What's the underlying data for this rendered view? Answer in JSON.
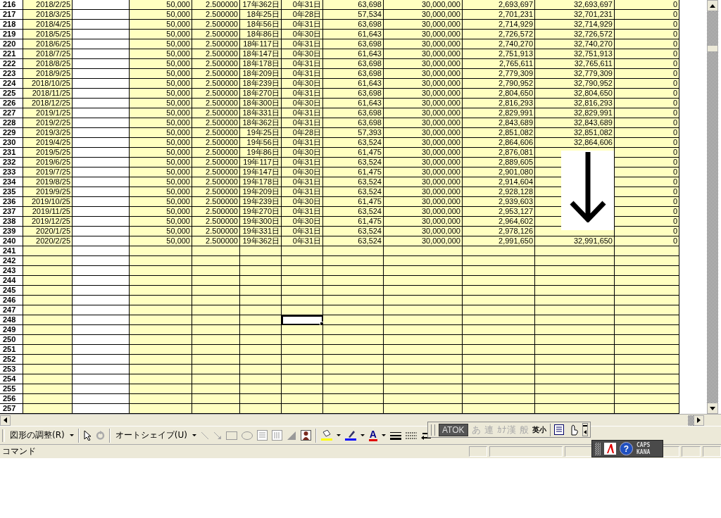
{
  "sheet": {
    "rows": [
      {
        "number": "216",
        "cells": [
          "2018/2/25",
          "50,000",
          "2.500000",
          "17年362日",
          "0年31日",
          "63,698",
          "30,000,000",
          "2,693,697",
          "32,693,697",
          "0"
        ]
      },
      {
        "number": "217",
        "cells": [
          "2018/3/25",
          "50,000",
          "2.500000",
          "18年25日",
          "0年28日",
          "57,534",
          "30,000,000",
          "2,701,231",
          "32,701,231",
          "0"
        ]
      },
      {
        "number": "218",
        "cells": [
          "2018/4/25",
          "50,000",
          "2.500000",
          "18年56日",
          "0年31日",
          "63,698",
          "30,000,000",
          "2,714,929",
          "32,714,929",
          "0"
        ]
      },
      {
        "number": "219",
        "cells": [
          "2018/5/25",
          "50,000",
          "2.500000",
          "18年86日",
          "0年30日",
          "61,643",
          "30,000,000",
          "2,726,572",
          "32,726,572",
          "0"
        ]
      },
      {
        "number": "220",
        "cells": [
          "2018/6/25",
          "50,000",
          "2.500000",
          "18年117日",
          "0年31日",
          "63,698",
          "30,000,000",
          "2,740,270",
          "32,740,270",
          "0"
        ]
      },
      {
        "number": "221",
        "cells": [
          "2018/7/25",
          "50,000",
          "2.500000",
          "18年147日",
          "0年30日",
          "61,643",
          "30,000,000",
          "2,751,913",
          "32,751,913",
          "0"
        ]
      },
      {
        "number": "222",
        "cells": [
          "2018/8/25",
          "50,000",
          "2.500000",
          "18年178日",
          "0年31日",
          "63,698",
          "30,000,000",
          "2,765,611",
          "32,765,611",
          "0"
        ]
      },
      {
        "number": "223",
        "cells": [
          "2018/9/25",
          "50,000",
          "2.500000",
          "18年209日",
          "0年31日",
          "63,698",
          "30,000,000",
          "2,779,309",
          "32,779,309",
          "0"
        ]
      },
      {
        "number": "224",
        "cells": [
          "2018/10/25",
          "50,000",
          "2.500000",
          "18年239日",
          "0年30日",
          "61,643",
          "30,000,000",
          "2,790,952",
          "32,790,952",
          "0"
        ]
      },
      {
        "number": "225",
        "cells": [
          "2018/11/25",
          "50,000",
          "2.500000",
          "18年270日",
          "0年31日",
          "63,698",
          "30,000,000",
          "2,804,650",
          "32,804,650",
          "0"
        ]
      },
      {
        "number": "226",
        "cells": [
          "2018/12/25",
          "50,000",
          "2.500000",
          "18年300日",
          "0年30日",
          "61,643",
          "30,000,000",
          "2,816,293",
          "32,816,293",
          "0"
        ]
      },
      {
        "number": "227",
        "cells": [
          "2019/1/25",
          "50,000",
          "2.500000",
          "18年331日",
          "0年31日",
          "63,698",
          "30,000,000",
          "2,829,991",
          "32,829,991",
          "0"
        ]
      },
      {
        "number": "228",
        "cells": [
          "2019/2/25",
          "50,000",
          "2.500000",
          "18年362日",
          "0年31日",
          "63,698",
          "30,000,000",
          "2,843,689",
          "32,843,689",
          "0"
        ]
      },
      {
        "number": "229",
        "cells": [
          "2019/3/25",
          "50,000",
          "2.500000",
          "19年25日",
          "0年28日",
          "57,393",
          "30,000,000",
          "2,851,082",
          "32,851,082",
          "0"
        ]
      },
      {
        "number": "230",
        "cells": [
          "2019/4/25",
          "50,000",
          "2.500000",
          "19年56日",
          "0年31日",
          "63,524",
          "30,000,000",
          "2,864,606",
          "32,864,606",
          "0"
        ]
      },
      {
        "number": "231",
        "cells": [
          "2019/5/25",
          "50,000",
          "2.500000",
          "19年86日",
          "0年30日",
          "61,475",
          "30,000,000",
          "2,876,081",
          null,
          "0"
        ]
      },
      {
        "number": "232",
        "cells": [
          "2019/6/25",
          "50,000",
          "2.500000",
          "19年117日",
          "0年31日",
          "63,524",
          "30,000,000",
          "2,889,605",
          null,
          "0"
        ]
      },
      {
        "number": "233",
        "cells": [
          "2019/7/25",
          "50,000",
          "2.500000",
          "19年147日",
          "0年30日",
          "61,475",
          "30,000,000",
          "2,901,080",
          null,
          "0"
        ]
      },
      {
        "number": "234",
        "cells": [
          "2019/8/25",
          "50,000",
          "2.500000",
          "19年178日",
          "0年31日",
          "63,524",
          "30,000,000",
          "2,914,604",
          null,
          "0"
        ]
      },
      {
        "number": "235",
        "cells": [
          "2019/9/25",
          "50,000",
          "2.500000",
          "19年209日",
          "0年31日",
          "63,524",
          "30,000,000",
          "2,928,128",
          null,
          "0"
        ]
      },
      {
        "number": "236",
        "cells": [
          "2019/10/25",
          "50,000",
          "2.500000",
          "19年239日",
          "0年30日",
          "61,475",
          "30,000,000",
          "2,939,603",
          null,
          "0"
        ]
      },
      {
        "number": "237",
        "cells": [
          "2019/11/25",
          "50,000",
          "2.500000",
          "19年270日",
          "0年31日",
          "63,524",
          "30,000,000",
          "2,953,127",
          null,
          "0"
        ]
      },
      {
        "number": "238",
        "cells": [
          "2019/12/25",
          "50,000",
          "2.500000",
          "19年300日",
          "0年30日",
          "61,475",
          "30,000,000",
          "2,964,602",
          null,
          "0"
        ]
      },
      {
        "number": "239",
        "cells": [
          "2020/1/25",
          "50,000",
          "2.500000",
          "19年331日",
          "0年31日",
          "63,524",
          "30,000,000",
          "2,978,126",
          null,
          "0"
        ]
      },
      {
        "number": "240",
        "cells": [
          "2020/2/25",
          "50,000",
          "2.500000",
          "19年362日",
          "0年31日",
          "63,524",
          "30,000,000",
          "2,991,650",
          "32,991,650",
          "0"
        ]
      },
      {
        "number": "241",
        "selected": false
      },
      {
        "number": "242",
        "selected": false
      },
      {
        "number": "243",
        "selected": false
      },
      {
        "number": "244",
        "selected": false
      },
      {
        "number": "245",
        "selected": false
      },
      {
        "number": "246",
        "selected": false
      },
      {
        "number": "247",
        "selected": false
      },
      {
        "number": "248",
        "selected": true
      },
      {
        "number": "249",
        "selected": false
      },
      {
        "number": "250",
        "selected": false
      },
      {
        "number": "251",
        "selected": false
      },
      {
        "number": "252",
        "selected": false
      },
      {
        "number": "253",
        "selected": false
      },
      {
        "number": "254",
        "selected": false
      },
      {
        "number": "255",
        "selected": false
      },
      {
        "number": "256",
        "selected": false
      },
      {
        "number": "257",
        "selected": false
      }
    ]
  },
  "drawing_toolbar": {
    "draw_menu": "図形の調整(R)",
    "autoshape_menu": "オートシェイプ(U)",
    "font_color_button": "A"
  },
  "ime_palette": {
    "items": [
      {
        "kind": "logo",
        "label": "ATOK",
        "disabled": false
      },
      {
        "kind": "mode",
        "label": "あ",
        "disabled": true
      },
      {
        "kind": "mode",
        "label": "連",
        "disabled": true
      },
      {
        "kind": "mode",
        "label": "ｶﾅ漢",
        "disabled": true
      },
      {
        "kind": "mode",
        "label": "般",
        "disabled": true
      },
      {
        "kind": "mode",
        "label": "英小",
        "disabled": false
      }
    ]
  },
  "language_bar": {
    "help": "?",
    "caps": "CAPS",
    "kana": "KANA"
  },
  "status_bar": {
    "text": "コマンド"
  }
}
